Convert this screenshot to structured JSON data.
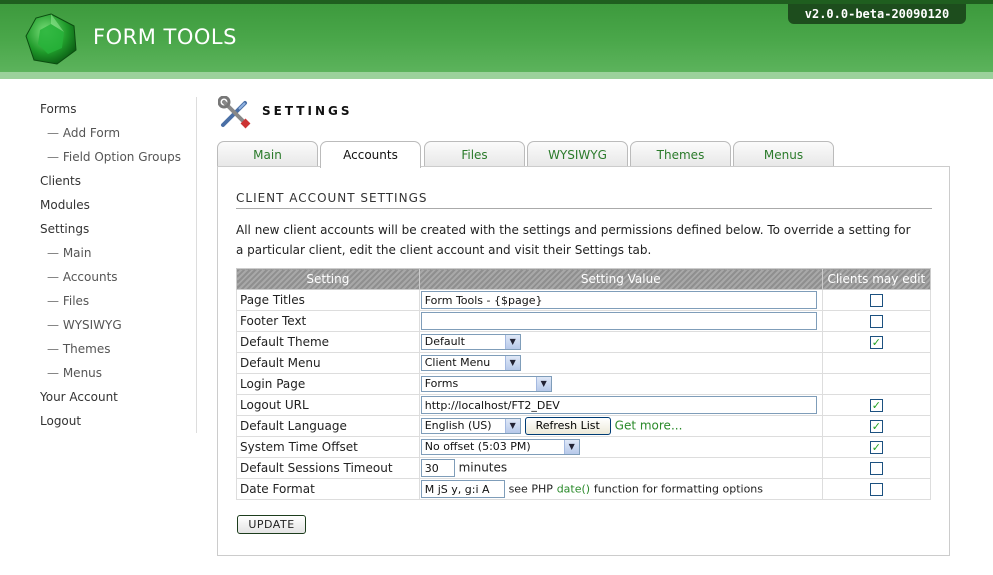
{
  "app": {
    "title": "FORM TOOLS",
    "version": "v2.0.0-beta-20090120"
  },
  "sidebar": {
    "items": [
      {
        "label": "Forms",
        "sub": false
      },
      {
        "label": "Add Form",
        "sub": true
      },
      {
        "label": "Field Option Groups",
        "sub": true
      },
      {
        "label": "Clients",
        "sub": false
      },
      {
        "label": "Modules",
        "sub": false
      },
      {
        "label": "Settings",
        "sub": false
      },
      {
        "label": "Main",
        "sub": true
      },
      {
        "label": "Accounts",
        "sub": true
      },
      {
        "label": "Files",
        "sub": true
      },
      {
        "label": "WYSIWYG",
        "sub": true
      },
      {
        "label": "Themes",
        "sub": true
      },
      {
        "label": "Menus",
        "sub": true
      },
      {
        "label": "Your Account",
        "sub": false
      },
      {
        "label": "Logout",
        "sub": false
      }
    ],
    "sub_prefix": "—"
  },
  "page": {
    "title": "SETTINGS",
    "icon": "wrench-screwdriver-icon"
  },
  "tabs": [
    {
      "label": "Main",
      "active": false
    },
    {
      "label": "Accounts",
      "active": true
    },
    {
      "label": "Files",
      "active": false
    },
    {
      "label": "WYSIWYG",
      "active": false
    },
    {
      "label": "Themes",
      "active": false
    },
    {
      "label": "Menus",
      "active": false
    }
  ],
  "section": {
    "title": "CLIENT ACCOUNT SETTINGS",
    "intro": "All new client accounts will be created with the settings and permissions defined below. To override a setting for a particular client, edit the client account and visit their Settings tab."
  },
  "table": {
    "headers": [
      "Setting",
      "Setting Value",
      "Clients may edit"
    ],
    "rows": {
      "page_titles": {
        "label": "Page Titles",
        "value": "Form Tools - {$page}",
        "editable": false
      },
      "footer_text": {
        "label": "Footer Text",
        "value": "",
        "editable": false
      },
      "default_theme": {
        "label": "Default Theme",
        "value": "Default",
        "editable": true
      },
      "default_menu": {
        "label": "Default Menu",
        "value": "Client Menu"
      },
      "login_page": {
        "label": "Login Page",
        "value": "Forms"
      },
      "logout_url": {
        "label": "Logout URL",
        "value": "http://localhost/FT2_DEV",
        "editable": true
      },
      "default_language": {
        "label": "Default Language",
        "value": "English (US)",
        "refresh_label": "Refresh List",
        "get_more": "Get more...",
        "editable": true
      },
      "time_offset": {
        "label": "System Time Offset",
        "value": "No offset (5:03 PM)",
        "editable": true
      },
      "sessions_timeout": {
        "label": "Default Sessions Timeout",
        "value": "30",
        "unit": "minutes",
        "editable": false
      },
      "date_format": {
        "label": "Date Format",
        "value": "M jS y, g:i A",
        "pre": "see PHP",
        "link": "date()",
        "post": "function for formatting options",
        "editable": false
      }
    }
  },
  "update_label": "UPDATE",
  "colors": {
    "header_green": "#4aa74a",
    "accent_green": "#2a8a2a",
    "version_bg": "#1d4d1d"
  }
}
